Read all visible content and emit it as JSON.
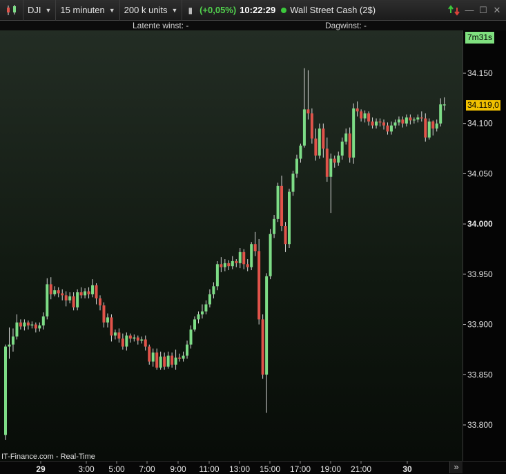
{
  "toolbar": {
    "instrument": "DJI",
    "timeframe": "15 minuten",
    "units": "200 k units",
    "change": "(+0,05%)",
    "time": "10:22:29",
    "market_name": "Wall Street Cash (2$)"
  },
  "infobar": {
    "latent_profit": "Latente winst: -",
    "day_profit": "Dagwinst: -"
  },
  "timer": "7m31s",
  "current_price": "34.119,0",
  "watermark": "IT-Finance.com - Real-Time",
  "colors": {
    "up": "#7ddc86",
    "down": "#e0534a",
    "wick": "#d8d8d8",
    "price_tag": "#f0c000",
    "timer_bg": "#7fe07f"
  },
  "icons": [
    "candle-chart-icon",
    "sync-arrows-icon",
    "minimize-icon",
    "maximize-icon",
    "close-icon",
    "scroll-right-icon"
  ],
  "chart_data": {
    "type": "candlestick",
    "y_ticks": [
      "34.150",
      "34.100",
      "34.050",
      "34.000",
      "33.950",
      "33.900",
      "33.850",
      "33.800"
    ],
    "y_tick_values": [
      34150,
      34100,
      34050,
      34000,
      33950,
      33900,
      33850,
      33800
    ],
    "x_ticks": [
      "29",
      "3:00",
      "5:00",
      "7:00",
      "9:00",
      "11:00",
      "13:00",
      "15:00",
      "17:00",
      "19:00",
      "21:00",
      "30"
    ],
    "grid": false,
    "candles": [
      [
        33790,
        33878,
        33785,
        33880
      ],
      [
        33878,
        33880,
        33866,
        33897
      ],
      [
        33880,
        33888,
        33873,
        33896
      ],
      [
        33888,
        33902,
        33885,
        33910
      ],
      [
        33902,
        33898,
        33895,
        33905
      ],
      [
        33898,
        33902,
        33894,
        33905
      ],
      [
        33902,
        33899,
        33895,
        33904
      ],
      [
        33899,
        33900,
        33896,
        33903
      ],
      [
        33900,
        33896,
        33892,
        33902
      ],
      [
        33896,
        33899,
        33893,
        33902
      ],
      [
        33899,
        33908,
        33895,
        33912
      ],
      [
        33908,
        33940,
        33905,
        33946
      ],
      [
        33940,
        33930,
        33925,
        33947
      ],
      [
        33930,
        33934,
        33928,
        33938
      ],
      [
        33934,
        33931,
        33927,
        33937
      ],
      [
        33931,
        33929,
        33924,
        33935
      ],
      [
        33929,
        33924,
        33918,
        33933
      ],
      [
        33924,
        33928,
        33921,
        33932
      ],
      [
        33928,
        33917,
        33914,
        33932
      ],
      [
        33917,
        33932,
        33914,
        33935
      ],
      [
        33932,
        33929,
        33926,
        33937
      ],
      [
        33929,
        33933,
        33926,
        33936
      ],
      [
        33933,
        33930,
        33926,
        33937
      ],
      [
        33930,
        33939,
        33927,
        33945
      ],
      [
        33939,
        33926,
        33920,
        33941
      ],
      [
        33926,
        33919,
        33914,
        33929
      ],
      [
        33919,
        33902,
        33897,
        33922
      ],
      [
        33902,
        33907,
        33897,
        33911
      ],
      [
        33907,
        33889,
        33883,
        33910
      ],
      [
        33889,
        33892,
        33885,
        33895
      ],
      [
        33892,
        33886,
        33882,
        33896
      ],
      [
        33886,
        33878,
        33875,
        33891
      ],
      [
        33878,
        33889,
        33874,
        33892
      ],
      [
        33889,
        33886,
        33882,
        33891
      ],
      [
        33886,
        33887,
        33883,
        33890
      ],
      [
        33887,
        33884,
        33880,
        33889
      ],
      [
        33884,
        33885,
        33881,
        33888
      ],
      [
        33885,
        33878,
        33874,
        33889
      ],
      [
        33878,
        33863,
        33860,
        33880
      ],
      [
        33863,
        33872,
        33858,
        33876
      ],
      [
        33872,
        33857,
        33855,
        33876
      ],
      [
        33857,
        33868,
        33855,
        33873
      ],
      [
        33868,
        33858,
        33855,
        33872
      ],
      [
        33858,
        33869,
        33856,
        33873
      ],
      [
        33869,
        33860,
        33857,
        33872
      ],
      [
        33860,
        33867,
        33855,
        33875
      ],
      [
        33867,
        33866,
        33863,
        33871
      ],
      [
        33866,
        33869,
        33863,
        33873
      ],
      [
        33869,
        33880,
        33866,
        33884
      ],
      [
        33880,
        33895,
        33876,
        33899
      ],
      [
        33895,
        33905,
        33893,
        33908
      ],
      [
        33905,
        33910,
        33901,
        33913
      ],
      [
        33910,
        33913,
        33906,
        33920
      ],
      [
        33913,
        33920,
        33910,
        33924
      ],
      [
        33920,
        33930,
        33917,
        33935
      ],
      [
        33930,
        33938,
        33926,
        33942
      ],
      [
        33938,
        33960,
        33934,
        33963
      ],
      [
        33960,
        33957,
        33952,
        33967
      ],
      [
        33957,
        33961,
        33953,
        33965
      ],
      [
        33961,
        33958,
        33954,
        33964
      ],
      [
        33958,
        33963,
        33955,
        33968
      ],
      [
        33963,
        33961,
        33957,
        33965
      ],
      [
        33961,
        33972,
        33956,
        33976
      ],
      [
        33972,
        33960,
        33955,
        33975
      ],
      [
        33960,
        33957,
        33953,
        33965
      ],
      [
        33957,
        33980,
        33954,
        33982
      ],
      [
        33980,
        33973,
        33968,
        33992
      ],
      [
        33973,
        33905,
        33900,
        33985
      ],
      [
        33905,
        33850,
        33846,
        33910
      ],
      [
        33850,
        33948,
        33812,
        33951
      ],
      [
        33948,
        33990,
        33945,
        33995
      ],
      [
        33990,
        34005,
        33986,
        34009
      ],
      [
        34005,
        34038,
        34002,
        34041
      ],
      [
        34038,
        33998,
        33993,
        34048
      ],
      [
        33998,
        33980,
        33972,
        34002
      ],
      [
        33980,
        34032,
        33976,
        34035
      ],
      [
        34032,
        34050,
        34028,
        34053
      ],
      [
        34050,
        34065,
        34046,
        34069
      ],
      [
        34065,
        34078,
        34061,
        34080
      ],
      [
        34078,
        34114,
        34076,
        34155
      ],
      [
        34114,
        34110,
        34104,
        34153
      ],
      [
        34110,
        34085,
        34080,
        34115
      ],
      [
        34085,
        34068,
        34063,
        34095
      ],
      [
        34068,
        34095,
        34065,
        34100
      ],
      [
        34095,
        34075,
        34066,
        34100
      ],
      [
        34075,
        34047,
        34042,
        34086
      ],
      [
        34047,
        34065,
        34011,
        34070
      ],
      [
        34065,
        34061,
        34056,
        34068
      ],
      [
        34061,
        34068,
        34058,
        34072
      ],
      [
        34068,
        34082,
        34064,
        34086
      ],
      [
        34082,
        34090,
        34079,
        34095
      ],
      [
        34090,
        34066,
        34061,
        34096
      ],
      [
        34066,
        34115,
        34060,
        34120
      ],
      [
        34115,
        34112,
        34107,
        34122
      ],
      [
        34112,
        34105,
        34102,
        34114
      ],
      [
        34105,
        34110,
        34101,
        34113
      ],
      [
        34110,
        34102,
        34098,
        34112
      ],
      [
        34102,
        34098,
        34095,
        34106
      ],
      [
        34098,
        34102,
        34095,
        34105
      ],
      [
        34102,
        34101,
        34097,
        34105
      ],
      [
        34101,
        34098,
        34094,
        34104
      ],
      [
        34098,
        34092,
        34089,
        34101
      ],
      [
        34092,
        34098,
        34089,
        34102
      ],
      [
        34098,
        34101,
        34095,
        34104
      ],
      [
        34101,
        34104,
        34098,
        34107
      ],
      [
        34104,
        34100,
        34096,
        34107
      ],
      [
        34100,
        34106,
        34097,
        34109
      ],
      [
        34106,
        34103,
        34099,
        34109
      ],
      [
        34103,
        34104,
        34100,
        34106
      ],
      [
        34104,
        34106,
        34101,
        34109
      ],
      [
        34106,
        34105,
        34102,
        34112
      ],
      [
        34105,
        34086,
        34082,
        34110
      ],
      [
        34086,
        34102,
        34084,
        34105
      ],
      [
        34102,
        34095,
        34088,
        34103
      ],
      [
        34095,
        34100,
        34092,
        34104
      ],
      [
        34100,
        34119,
        34097,
        34125
      ],
      [
        34119,
        34119,
        34113,
        34126
      ]
    ]
  }
}
